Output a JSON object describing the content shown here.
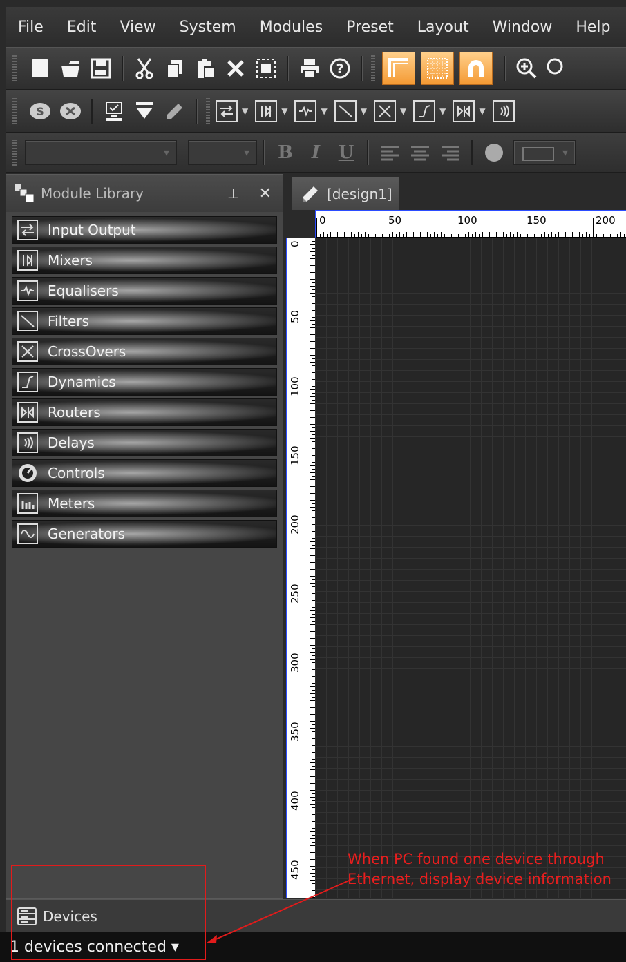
{
  "menu": [
    "File",
    "Edit",
    "View",
    "System",
    "Modules",
    "Preset",
    "Layout",
    "Window",
    "Help"
  ],
  "toolbar_icons": [
    "new-file-icon",
    "open-folder-icon",
    "save-icon",
    "cut-icon",
    "copy-icon",
    "paste-icon",
    "delete-icon",
    "select-all-icon",
    "print-icon",
    "help-icon",
    "snap-to-grid-icon",
    "grid-icon",
    "magnet-icon",
    "zoom-in-icon"
  ],
  "toolbar2_icons": [
    "compile-icon",
    "disconnect-icon",
    "device-icon",
    "download-icon",
    "edit-icon"
  ],
  "module_toolbar": [
    "input-output",
    "mixers",
    "equalisers",
    "filters",
    "crossovers",
    "dynamics",
    "routers",
    "delays"
  ],
  "panel": {
    "title": "Module Library",
    "items": [
      {
        "label": "Input Output",
        "icon": "input-output-icon"
      },
      {
        "label": "Mixers",
        "icon": "mixer-icon"
      },
      {
        "label": "Equalisers",
        "icon": "equaliser-icon"
      },
      {
        "label": "Filters",
        "icon": "filter-icon"
      },
      {
        "label": "CrossOvers",
        "icon": "crossover-icon"
      },
      {
        "label": "Dynamics",
        "icon": "dynamics-icon"
      },
      {
        "label": "Routers",
        "icon": "router-icon"
      },
      {
        "label": "Delays",
        "icon": "delay-icon"
      },
      {
        "label": "Controls",
        "icon": "controls-icon"
      },
      {
        "label": "Meters",
        "icon": "meter-icon"
      },
      {
        "label": "Generators",
        "icon": "generator-icon"
      }
    ]
  },
  "document": {
    "tab": "[design1]",
    "h_ticks": [
      "0",
      "50",
      "100",
      "150",
      "200"
    ],
    "v_ticks": [
      "0",
      "50",
      "100",
      "150",
      "200",
      "250",
      "300",
      "350",
      "400",
      "450"
    ]
  },
  "devices": {
    "label": "Devices"
  },
  "status": {
    "text": "1 devices connected ▾"
  },
  "annotation": {
    "line1": "When PC found one device through",
    "line2": "Ethernet, display device information"
  },
  "colors": {
    "accent_orange": "#f49a34",
    "annotation_red": "#e81e1e",
    "ruler_blue": "#2b4cff"
  }
}
